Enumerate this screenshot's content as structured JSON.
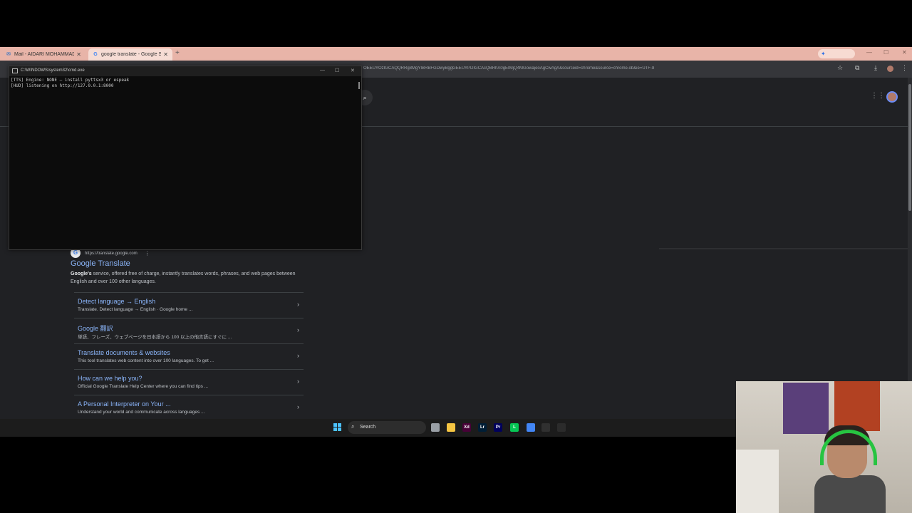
{
  "browser": {
    "tabs": [
      {
        "label": "Mail - AIDARI MOHAMMAD -",
        "icon": "outlook-icon"
      },
      {
        "label": "google translate - Google Sea",
        "icon": "google-icon"
      }
    ],
    "url_fragment": "OEEUYOzIGCAQQRRg8MgYIBRBFGDwyBggGEEUYPDIGCAcQBRhA0gEIMjQ4MGowajeoAgCwAgA&sourceid=chrome&source=chrome.ob&ie=UTF-8"
  },
  "result": {
    "url": "https://translate.google.com",
    "title": "Google Translate",
    "snippet_bold": "Google's",
    "snippet_rest": " service, offered free of charge, instantly translates words, phrases, and web pages between English and over 100 other languages."
  },
  "sitelinks": [
    {
      "title": "Detect language → English",
      "desc": "Translate. Detect language → English · Google home ..."
    },
    {
      "title": "Google 翻訳",
      "desc": "単語、フレーズ、ウェブページを日本語から 100 以上の他言語にすぐに ..."
    },
    {
      "title": "Translate documents & websites",
      "desc": "This tool translates web content into over 100 languages. To get ..."
    },
    {
      "title": "How can we help you?",
      "desc": "Official Google Translate Help Center where you can find tips ..."
    },
    {
      "title": "A Personal Interpreter on Your ...",
      "desc": "Understand your world and communicate across languages ..."
    }
  ],
  "console": {
    "title": "C:\\WINDOWS\\system32\\cmd.exe",
    "lines": "[TTS] Engine: NONE — install pyttsx3 or espeak\n[HUD] listening on http://127.0.0.1:8000"
  },
  "taskbar": {
    "search_label": "Search",
    "apps": [
      {
        "name": "task-view",
        "glyph": "",
        "color": "#9aa0a6"
      },
      {
        "name": "file-explorer",
        "glyph": "",
        "color": "#f5c542"
      },
      {
        "name": "adobe-xd",
        "glyph": "Xd",
        "color": "#470137"
      },
      {
        "name": "lightroom",
        "glyph": "Lr",
        "color": "#001e36"
      },
      {
        "name": "premiere",
        "glyph": "Pr",
        "color": "#00005b"
      },
      {
        "name": "line",
        "glyph": "L",
        "color": "#06c755"
      },
      {
        "name": "chrome",
        "glyph": "",
        "color": "#4285f4"
      },
      {
        "name": "obs",
        "glyph": "",
        "color": "#303030"
      },
      {
        "name": "terminal",
        "glyph": "",
        "color": "#2b2b2b"
      }
    ]
  }
}
